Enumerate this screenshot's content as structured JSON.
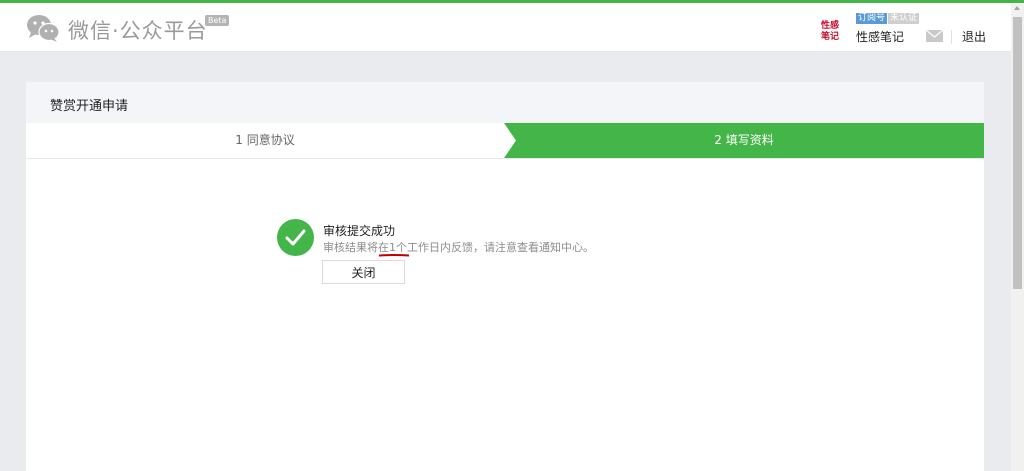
{
  "header": {
    "brand": "微信·公众平台",
    "beta": "Beta",
    "account_badge_type": "订阅号",
    "account_badge_status": "未认证",
    "account_name": "性感笔记",
    "account_avatar_text": "性感笔记",
    "logout_label": "退出"
  },
  "card": {
    "title": "赞赏开通申请",
    "steps": [
      {
        "label": "1 同意协议",
        "active": false
      },
      {
        "label": "2 填写资料",
        "active": true
      }
    ],
    "result": {
      "title": "审核提交成功",
      "description": "审核结果将在1个工作日内反馈，请注意查看通知中心。",
      "close_label": "关闭"
    }
  },
  "colors": {
    "accent_green": "#44b549",
    "annotation_red": "#c00000"
  },
  "icons": [
    "wechat-logo-icon",
    "mail-icon",
    "check-circle-icon"
  ]
}
